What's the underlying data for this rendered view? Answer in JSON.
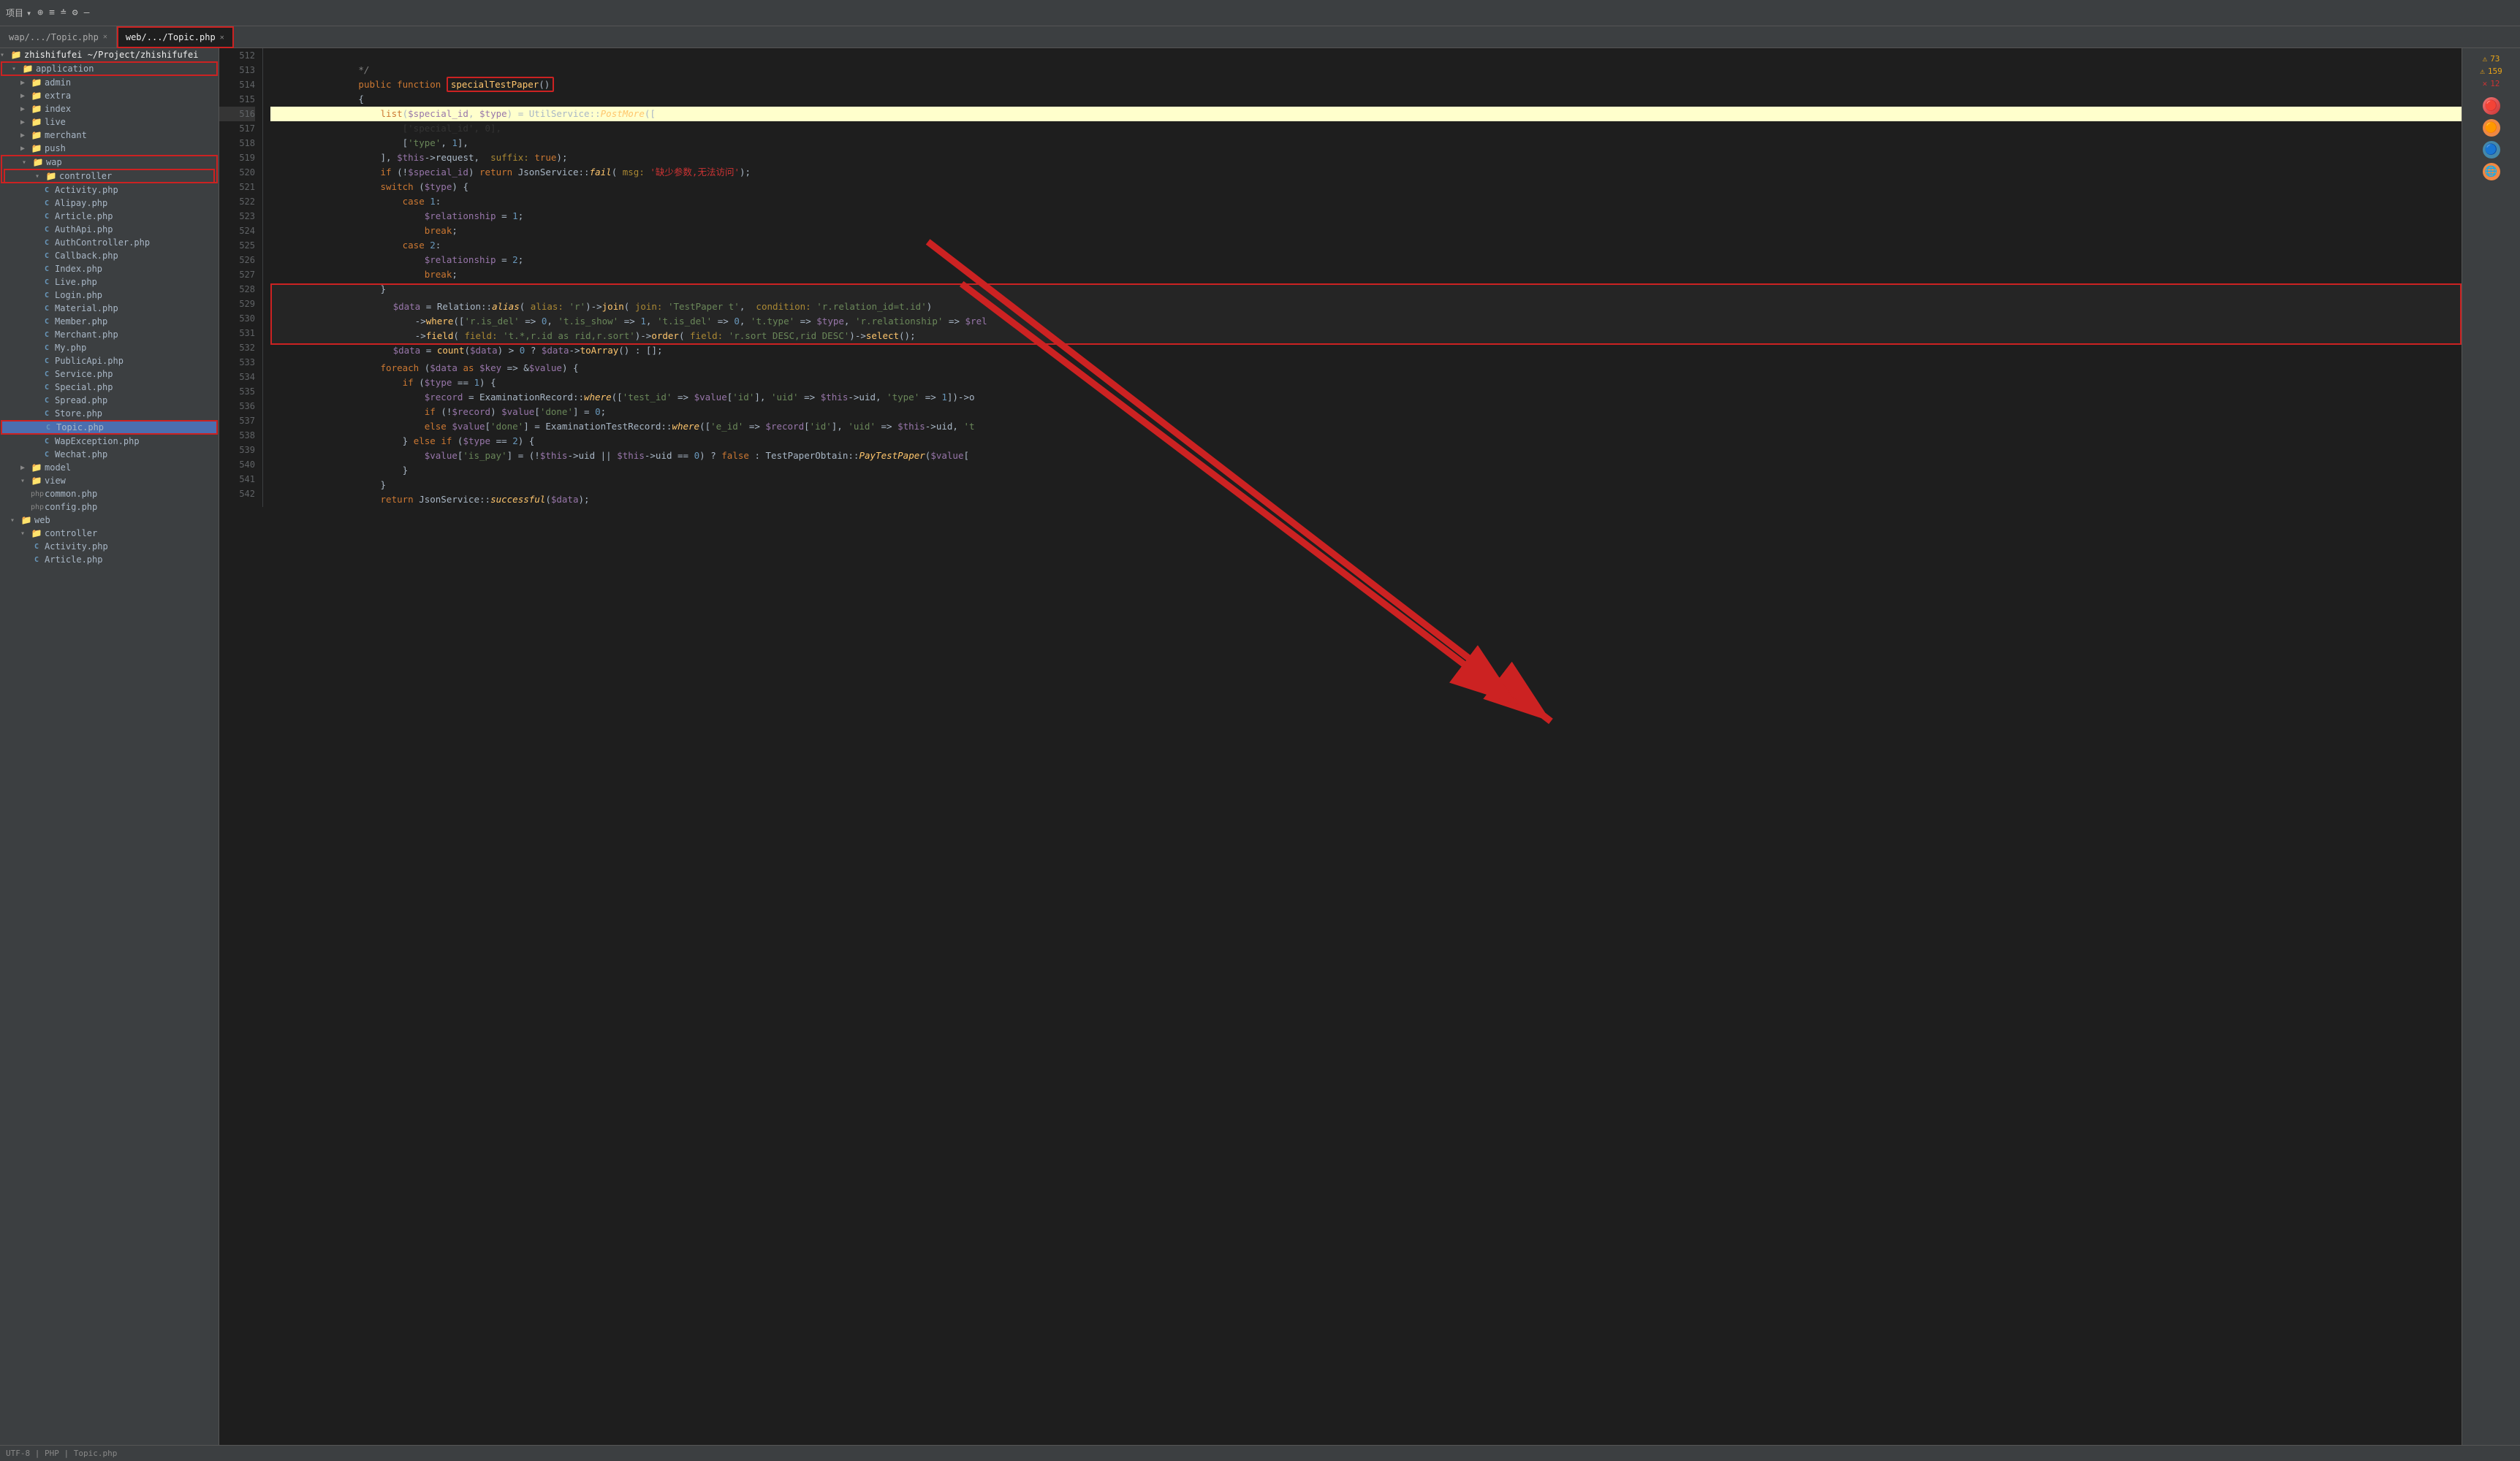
{
  "toolbar": {
    "project_label": "项目",
    "icons": [
      "⊕",
      "≡",
      "≐",
      "⚙",
      "—"
    ]
  },
  "tabs": [
    {
      "label": "wap/.../Topic.php",
      "active": false,
      "closable": true
    },
    {
      "label": "web/.../Topic.php",
      "active": true,
      "closable": true
    }
  ],
  "sidebar": {
    "root": "zhishifufei ~/Project/zhishifufei",
    "tree": [
      {
        "indent": 0,
        "type": "folder",
        "label": "application",
        "expanded": true,
        "boxed": true
      },
      {
        "indent": 1,
        "type": "folder",
        "label": "admin",
        "expanded": false
      },
      {
        "indent": 1,
        "type": "folder",
        "label": "extra",
        "expanded": false
      },
      {
        "indent": 1,
        "type": "folder",
        "label": "index",
        "expanded": false
      },
      {
        "indent": 1,
        "type": "folder",
        "label": "live",
        "expanded": false
      },
      {
        "indent": 1,
        "type": "folder",
        "label": "merchant",
        "expanded": false
      },
      {
        "indent": 1,
        "type": "folder",
        "label": "push",
        "expanded": false
      },
      {
        "indent": 1,
        "type": "folder",
        "label": "wap",
        "expanded": true,
        "boxed": true
      },
      {
        "indent": 2,
        "type": "folder",
        "label": "controller",
        "expanded": true,
        "boxed": true
      },
      {
        "indent": 3,
        "type": "file",
        "label": "Activity.php"
      },
      {
        "indent": 3,
        "type": "file",
        "label": "Alipay.php"
      },
      {
        "indent": 3,
        "type": "file",
        "label": "Article.php"
      },
      {
        "indent": 3,
        "type": "file",
        "label": "AuthApi.php"
      },
      {
        "indent": 3,
        "type": "file",
        "label": "AuthController.php"
      },
      {
        "indent": 3,
        "type": "file",
        "label": "Callback.php"
      },
      {
        "indent": 3,
        "type": "file",
        "label": "Index.php"
      },
      {
        "indent": 3,
        "type": "file",
        "label": "Live.php"
      },
      {
        "indent": 3,
        "type": "file",
        "label": "Login.php"
      },
      {
        "indent": 3,
        "type": "file",
        "label": "Material.php"
      },
      {
        "indent": 3,
        "type": "file",
        "label": "Member.php"
      },
      {
        "indent": 3,
        "type": "file",
        "label": "Merchant.php"
      },
      {
        "indent": 3,
        "type": "file",
        "label": "My.php"
      },
      {
        "indent": 3,
        "type": "file",
        "label": "PublicApi.php"
      },
      {
        "indent": 3,
        "type": "file",
        "label": "Service.php"
      },
      {
        "indent": 3,
        "type": "file",
        "label": "Special.php"
      },
      {
        "indent": 3,
        "type": "file",
        "label": "Spread.php"
      },
      {
        "indent": 3,
        "type": "file",
        "label": "Store.php"
      },
      {
        "indent": 3,
        "type": "file",
        "label": "Topic.php",
        "selected": true,
        "boxed": true
      },
      {
        "indent": 3,
        "type": "file",
        "label": "WapException.php"
      },
      {
        "indent": 3,
        "type": "file",
        "label": "Wechat.php"
      },
      {
        "indent": 2,
        "type": "folder",
        "label": "model",
        "expanded": false
      },
      {
        "indent": 2,
        "type": "folder",
        "label": "view",
        "expanded": false
      },
      {
        "indent": 3,
        "type": "file-php",
        "label": "common.php"
      },
      {
        "indent": 3,
        "type": "file-php",
        "label": "config.php"
      },
      {
        "indent": 1,
        "type": "folder",
        "label": "web",
        "expanded": true
      },
      {
        "indent": 2,
        "type": "folder",
        "label": "controller",
        "expanded": true
      },
      {
        "indent": 3,
        "type": "file",
        "label": "Activity.php"
      },
      {
        "indent": 3,
        "type": "file",
        "label": "Article.php"
      }
    ]
  },
  "editor": {
    "lines": [
      {
        "num": 512,
        "content": "    */",
        "type": "normal"
      },
      {
        "num": 513,
        "content": "    public function specialTestPaper()",
        "type": "normal"
      },
      {
        "num": 514,
        "content": "    {",
        "type": "normal"
      },
      {
        "num": 515,
        "content": "        list($special_id, $type) = UtilService::PostMore([",
        "type": "normal"
      },
      {
        "num": 516,
        "content": "            ['special_id', 0],",
        "type": "highlighted"
      },
      {
        "num": 517,
        "content": "            ['type', 1],",
        "type": "normal"
      },
      {
        "num": 518,
        "content": "        ], $this->request,  suffix: true);",
        "type": "normal"
      },
      {
        "num": 519,
        "content": "        if (!$special_id) return JsonService::fail( msg: '缺少参数,无法访问');",
        "type": "normal"
      },
      {
        "num": 520,
        "content": "        switch ($type) {",
        "type": "normal"
      },
      {
        "num": 521,
        "content": "            case 1:",
        "type": "normal"
      },
      {
        "num": 522,
        "content": "                $relationship = 1;",
        "type": "normal"
      },
      {
        "num": 523,
        "content": "                break;",
        "type": "normal"
      },
      {
        "num": 524,
        "content": "            case 2:",
        "type": "normal"
      },
      {
        "num": 525,
        "content": "                $relationship = 2;",
        "type": "normal"
      },
      {
        "num": 526,
        "content": "                break;",
        "type": "normal"
      },
      {
        "num": 527,
        "content": "        }",
        "type": "normal"
      },
      {
        "num": 528,
        "content": "        $data = Relation::alias( alias: 'r')->join( join: 'TestPaper t',  condition: 'r.relation_id=t.id')",
        "type": "boxed"
      },
      {
        "num": 529,
        "content": "            ->where(['r.is_del' => 0, 't.is_show' => 1, 't.is_del' => 0, 't.type' => $type, 'r.relationship' => $rel",
        "type": "boxed"
      },
      {
        "num": 530,
        "content": "            ->field( field: 't.*,r.id as rid,r.sort')->order( field: 'r.sort DESC,rid DESC')->select();",
        "type": "boxed"
      },
      {
        "num": 531,
        "content": "        $data = count($data) > 0 ? $data->toArray() : [];",
        "type": "boxed"
      },
      {
        "num": 532,
        "content": "        foreach ($data as $key => &$value) {",
        "type": "normal"
      },
      {
        "num": 533,
        "content": "            if ($type == 1) {",
        "type": "normal"
      },
      {
        "num": 534,
        "content": "                $record = ExaminationRecord::where(['test_id' => $value['id'], 'uid' => $this->uid, 'type' => 1])->o",
        "type": "normal"
      },
      {
        "num": 535,
        "content": "                if (!$record) $value['done'] = 0;",
        "type": "normal"
      },
      {
        "num": 536,
        "content": "                else $value['done'] = ExaminationTestRecord::where(['e_id' => $record['id'], 'uid' => $this->uid, 't",
        "type": "normal"
      },
      {
        "num": 537,
        "content": "            } else if ($type == 2) {",
        "type": "normal"
      },
      {
        "num": 538,
        "content": "                $value['is_pay'] = (!$this->uid || $this->uid == 0) ? false : TestPaperObtain::PayTestPaper($value[",
        "type": "normal"
      },
      {
        "num": 539,
        "content": "            }",
        "type": "normal"
      },
      {
        "num": 540,
        "content": "        }",
        "type": "normal"
      },
      {
        "num": 541,
        "content": "        return JsonService::successful($data);",
        "type": "normal"
      },
      {
        "num": 542,
        "content": "    }",
        "type": "normal"
      }
    ]
  },
  "status_bar": {
    "warnings": "73",
    "errors_1": "159",
    "errors_2": "12"
  }
}
